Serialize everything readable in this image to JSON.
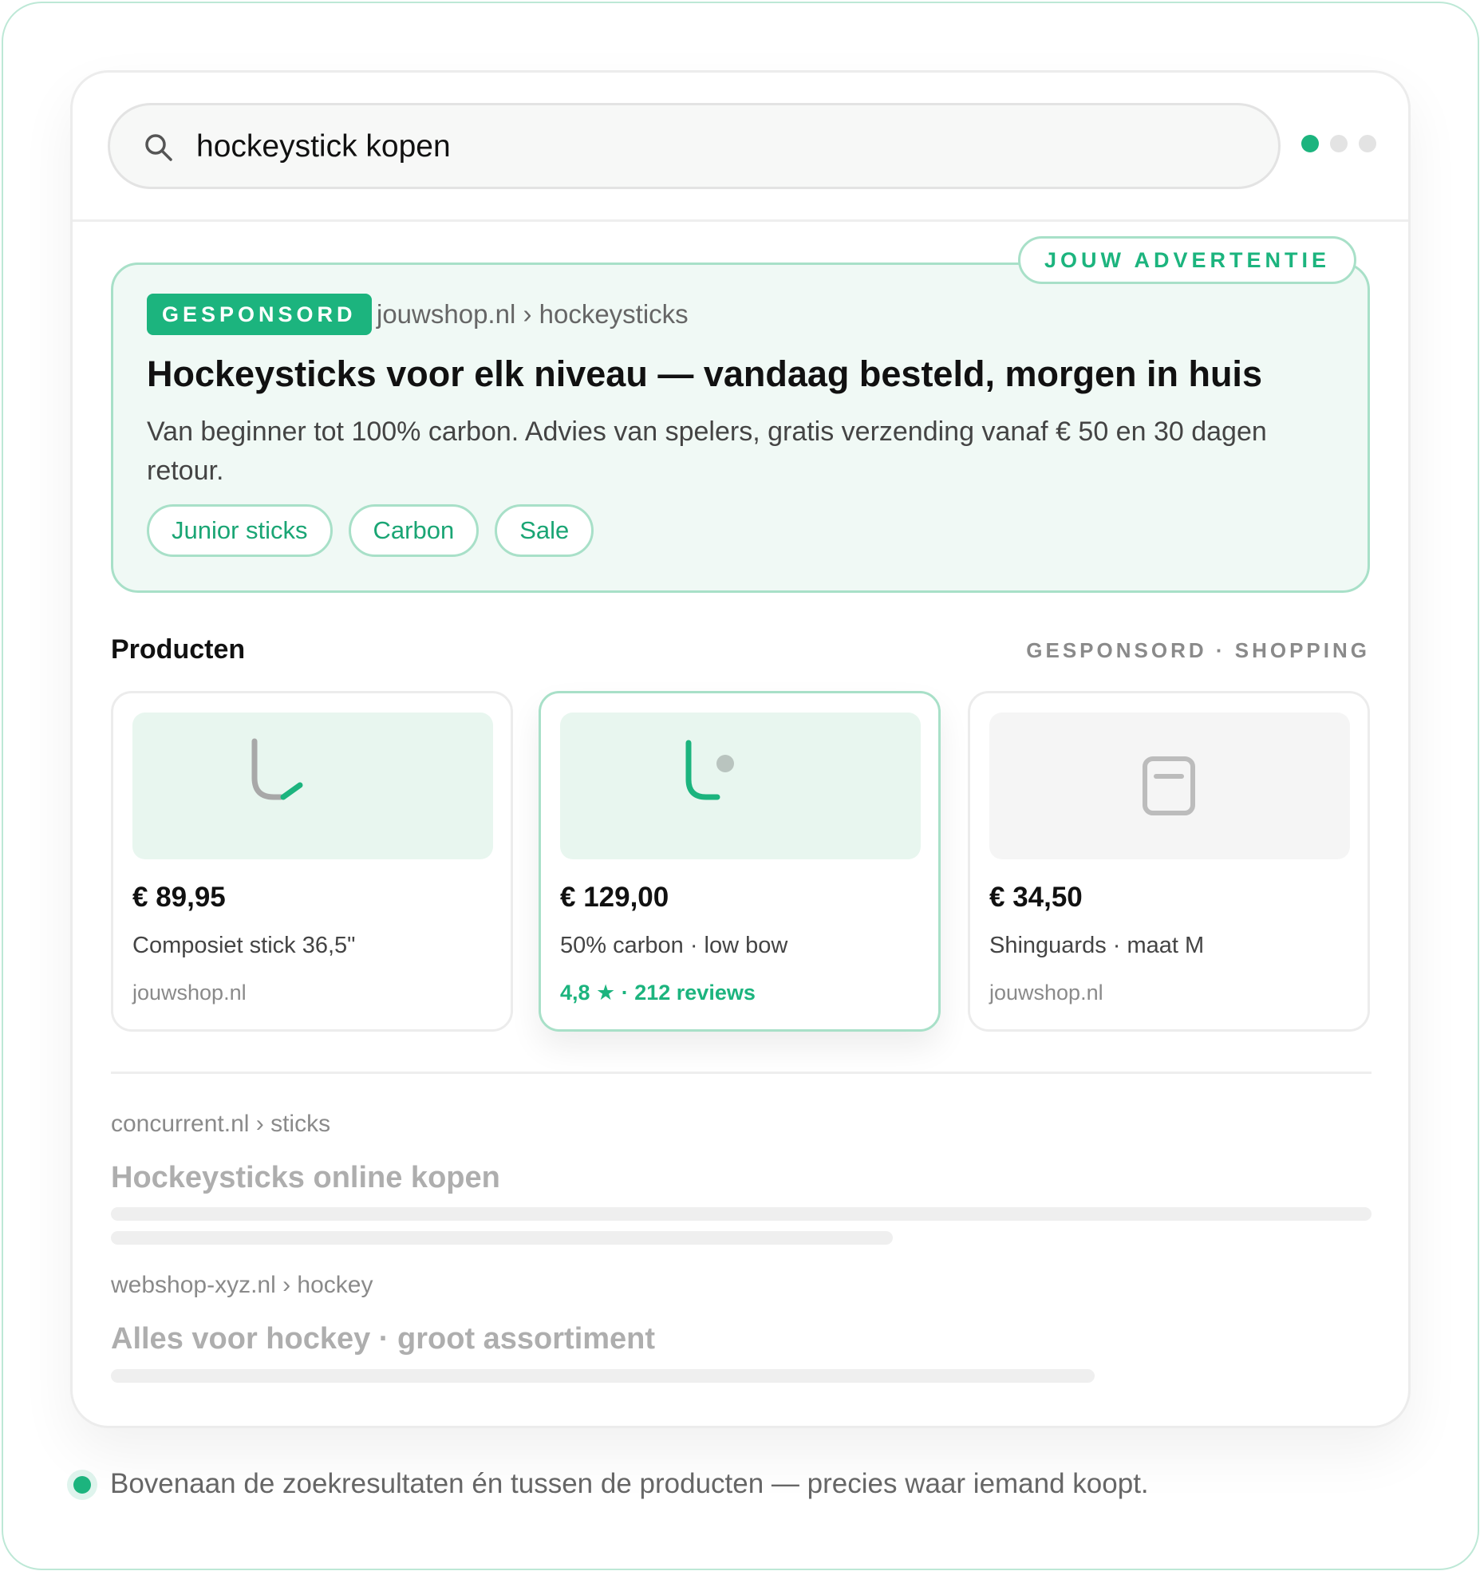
{
  "search": {
    "query": "hockeystick kopen"
  },
  "ad": {
    "tag": "JOUW ADVERTENTIE",
    "badge": "GESPONSORD",
    "url": "jouwshop.nl › hockeysticks",
    "title": "Hockeysticks voor elk niveau — vandaag besteld, morgen in huis",
    "description": "Van beginner tot 100% carbon. Advies van spelers, gratis verzending vanaf € 50 en 30 dagen retour.",
    "chips": [
      "Junior sticks",
      "Carbon",
      "Sale"
    ]
  },
  "products": {
    "title": "Producten",
    "meta": "GESPONSORD · SHOPPING",
    "items": [
      {
        "price": "€ 89,95",
        "name": "Composiet stick 36,5\"",
        "sub": "jouwshop.nl",
        "icon": "hockey-stick-icon"
      },
      {
        "price": "€ 129,00",
        "name": "50% carbon · low bow",
        "sub": "4,8 ★ · 212 reviews",
        "icon": "hockey-stick-ball-icon"
      },
      {
        "price": "€ 34,50",
        "name": "Shinguards · maat M",
        "sub": "jouwshop.nl",
        "icon": "shinguard-icon"
      }
    ]
  },
  "organic": [
    {
      "url": "concurrent.nl › sticks",
      "title": "Hockeysticks online kopen"
    },
    {
      "url": "webshop-xyz.nl › hockey",
      "title": "Alles voor hockey · groot assortiment"
    }
  ],
  "footnote": "Bovenaan de zoekresultaten én tussen de producten — precies waar iemand koopt.",
  "colors": {
    "accent": "#1cb47e",
    "accent_light": "#f0f9f5",
    "border_accent": "#a8e0c8"
  }
}
